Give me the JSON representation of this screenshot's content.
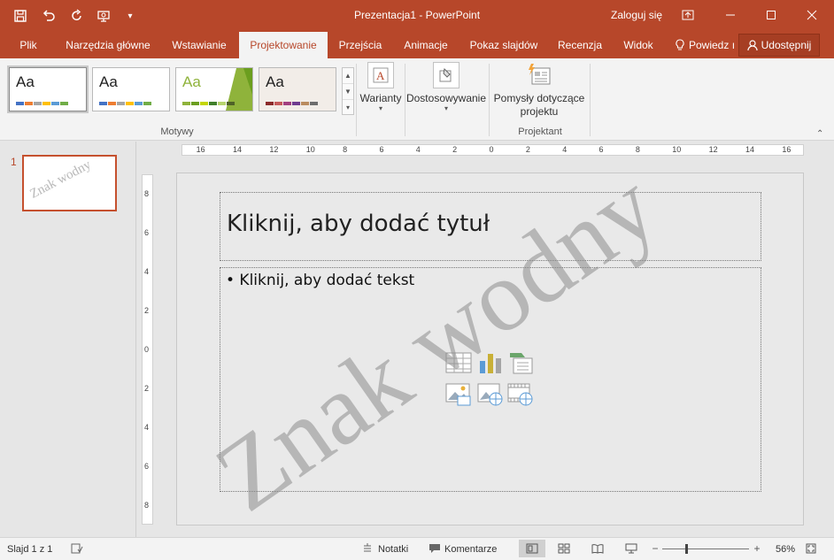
{
  "window": {
    "title": "Prezentacja1 - PowerPoint",
    "signin": "Zaloguj się"
  },
  "tabs": [
    {
      "label": "Plik",
      "active": false
    },
    {
      "label": "Narzędzia główne",
      "active": false
    },
    {
      "label": "Wstawianie",
      "active": false
    },
    {
      "label": "Projektowanie",
      "active": true
    },
    {
      "label": "Przejścia",
      "active": false
    },
    {
      "label": "Animacje",
      "active": false
    },
    {
      "label": "Pokaz slajdów",
      "active": false
    },
    {
      "label": "Recenzja",
      "active": false
    },
    {
      "label": "Widok",
      "active": false
    }
  ],
  "tell_me": "Powiedz ı",
  "share": "Udostępnij",
  "ribbon": {
    "themes_group": "Motywy",
    "themes": [
      {
        "label": "Aa",
        "aa_color": "#222222",
        "bg": "#ffffff",
        "colors": [
          "#4472c4",
          "#ed7d31",
          "#a5a5a5",
          "#ffc000",
          "#5b9bd5",
          "#70ad47"
        ]
      },
      {
        "label": "Aa",
        "aa_color": "#222222",
        "bg": "#ffffff",
        "colors": [
          "#4472c4",
          "#ed7d31",
          "#a5a5a5",
          "#ffc000",
          "#5b9bd5",
          "#70ad47"
        ]
      },
      {
        "label": "Aa",
        "aa_color": "#8fb33b",
        "bg": "#ffffff",
        "colors": [
          "#8fb33b",
          "#6b9e1f",
          "#c4d600",
          "#3f7f2a",
          "#b6d46e",
          "#4f6228"
        ]
      },
      {
        "label": "Aa",
        "aa_color": "#333333",
        "bg": "#f2ede8",
        "colors": [
          "#8b2a2a",
          "#c55a5a",
          "#a23f80",
          "#6e3b8f",
          "#b98b5f",
          "#6d6d6d"
        ]
      }
    ],
    "variants": "Warianty",
    "customize": "Dostosowywanie",
    "ideas": "Pomysły dotyczące projektu",
    "designer_group": "Projektant"
  },
  "slides_pane": {
    "slide_number": "1",
    "thumb_watermark": "Znak wodny"
  },
  "ruler": {
    "h_labels": [
      "16",
      "14",
      "12",
      "10",
      "8",
      "6",
      "4",
      "2",
      "0",
      "2",
      "4",
      "6",
      "8",
      "10",
      "12",
      "14",
      "16"
    ],
    "v_labels": [
      "8",
      "6",
      "4",
      "2",
      "0",
      "2",
      "4",
      "6",
      "8"
    ]
  },
  "slide": {
    "title_placeholder": "Kliknij, aby dodać tytuł",
    "body_placeholder": "• Kliknij, aby dodać tekst",
    "watermark": "Znak wodny"
  },
  "status": {
    "slide_info": "Slajd 1 z 1",
    "notes": "Notatki",
    "comments": "Komentarze",
    "zoom": "56%",
    "zoom_fraction": 0.28
  }
}
